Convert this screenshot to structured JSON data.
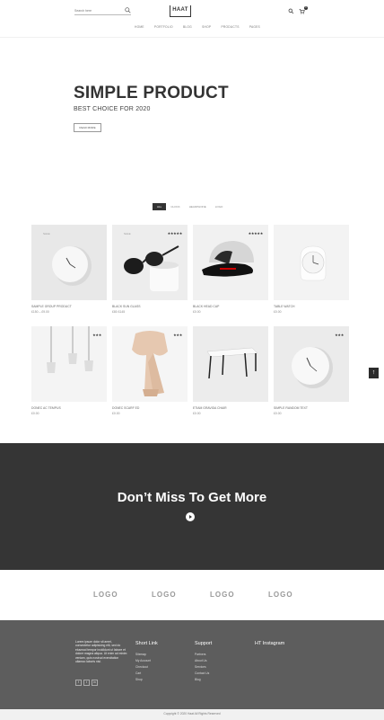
{
  "header": {
    "search_placeholder": "Search here",
    "logo": "HAAT",
    "cart_count": "0",
    "nav": [
      "HOME",
      "PORTFOLIO",
      "BLOG",
      "SHOP",
      "PRODUCTS",
      "PAGES"
    ]
  },
  "hero": {
    "title": "SIMPLE PRODUCT",
    "subtitle": "BEST CHOICE FOR 2020",
    "button": "READ MORE"
  },
  "filters": [
    "ALL",
    "CLOCK",
    "HEADPHONE",
    "LOGO"
  ],
  "products": [
    {
      "name": "SAMPLE GROUP PRODUCT",
      "price": "£150 – £9.00",
      "badge": "SALE",
      "stars": ""
    },
    {
      "name": "BLACK SUN GLASS",
      "price": "£80 £145",
      "badge": "SALE",
      "stars": "★★★★★"
    },
    {
      "name": "BLACK HEAD CAP",
      "price": "£0.00",
      "badge": "",
      "stars": "★★★★★"
    },
    {
      "name": "TABLE WATCH",
      "price": "£0.00",
      "badge": "",
      "stars": ""
    },
    {
      "name": "DONEC AC TEMPUS",
      "price": "£0.00",
      "badge": "",
      "stars": "★★★"
    },
    {
      "name": "DONEC SCARF ED",
      "price": "£0.00",
      "badge": "",
      "stars": "★★★"
    },
    {
      "name": "ETIAM GRAVIDA CHAIR",
      "price": "£0.00",
      "badge": "",
      "stars": ""
    },
    {
      "name": "SIMPLE RANDOM TEXT",
      "price": "£0.00",
      "badge": "",
      "stars": "★★★"
    }
  ],
  "scroll_top": "↑",
  "banner": {
    "title": "Don’t Miss To Get More"
  },
  "logos": [
    "LOGO",
    "LOGO",
    "LOGO",
    "LOGO"
  ],
  "footer": {
    "about": "Lorem ipsum dolor sit amet, consectetur adipisicing elit, sed do eiusmod tempor incididunt ut labore et dolore magna aliqua. Ut enim ad minim veniam, quis nostrud exercitation ullamco laboris nisi.",
    "social": [
      "f",
      "t",
      "in"
    ],
    "short_link_title": "Short Link",
    "short_links": [
      "Sitemap",
      "My Account",
      "Checkout",
      "Cart",
      "Shop"
    ],
    "support_title": "Support",
    "support_links": [
      "Partners",
      "About Us",
      "Services",
      "Contact Us",
      "Blog"
    ],
    "instagram_title": "HT Instagram",
    "copyright": "Copyright © 2020 Haat All Rights Reserved"
  }
}
